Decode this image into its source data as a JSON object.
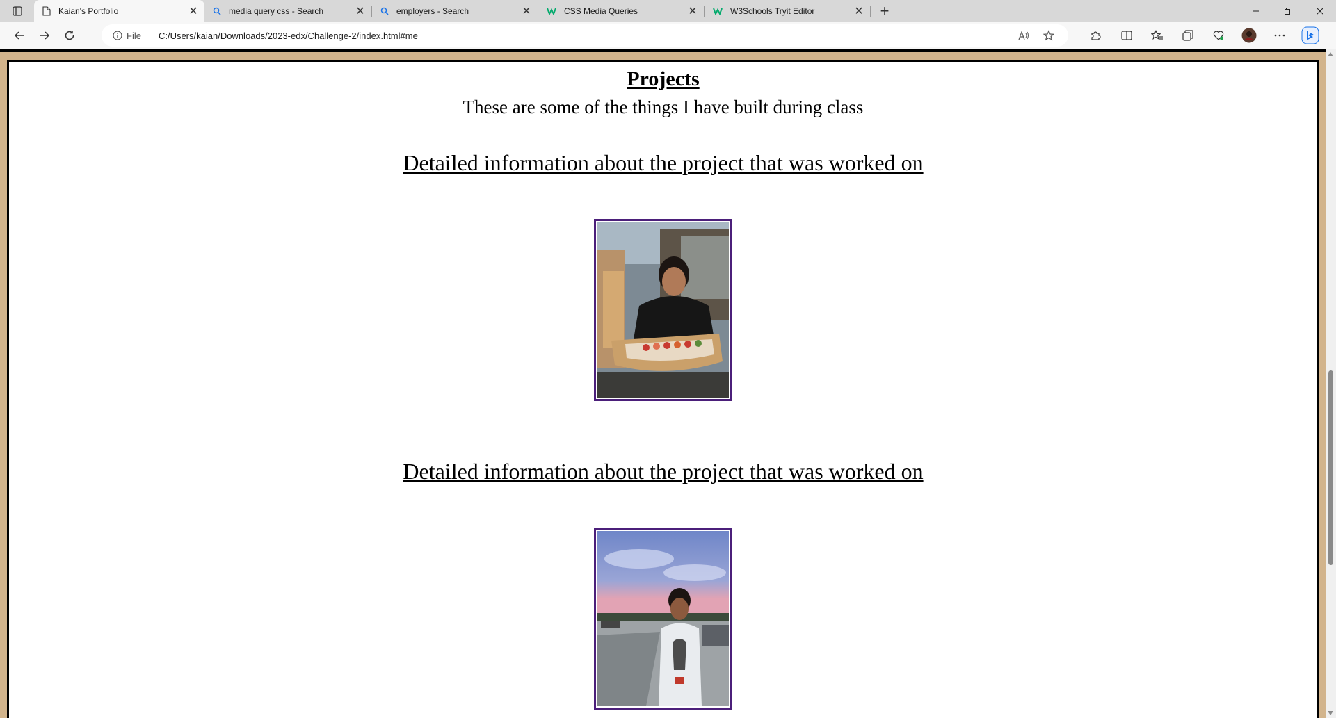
{
  "browser": {
    "tabs": [
      {
        "title": "Kaian's Portfolio",
        "icon": "page-icon",
        "active": true
      },
      {
        "title": "media query css - Search",
        "icon": "search-icon",
        "active": false
      },
      {
        "title": "employers - Search",
        "icon": "search-icon",
        "active": false
      },
      {
        "title": "CSS Media Queries",
        "icon": "w3schools-icon",
        "active": false
      },
      {
        "title": "W3Schools Tryit Editor",
        "icon": "w3schools-icon",
        "active": false
      }
    ],
    "close_glyph": "✕",
    "newtab_glyph": "+",
    "address": {
      "site_label": "File",
      "url": "C:/Users/kaian/Downloads/2023-edx/Challenge-2/index.html#me"
    },
    "accent_color": "#1a73e8"
  },
  "page": {
    "background_color": "#d2b48c",
    "frame_color": "#4b1f7a",
    "section_title": "Projects",
    "section_intro": "These are some of the things I have built during class",
    "projects": [
      {
        "heading": "Detailed information about the project that was worked on",
        "photo": "person-with-sushi-boat-photo"
      },
      {
        "heading": "Detailed information about the project that was worked on",
        "photo": "person-at-sunset-street-photo"
      }
    ]
  }
}
